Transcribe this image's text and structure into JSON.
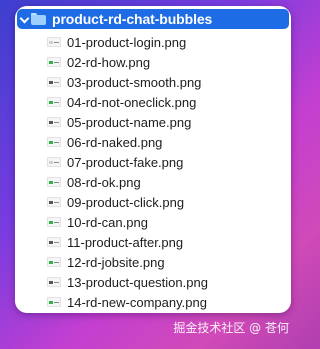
{
  "folder": {
    "name": "product-rd-chat-bubbles",
    "expanded": true
  },
  "files": [
    {
      "name": "01-product-login.png",
      "thumb_style": "plain"
    },
    {
      "name": "02-rd-how.png",
      "thumb_style": "green"
    },
    {
      "name": "03-product-smooth.png",
      "thumb_style": "dark"
    },
    {
      "name": "04-rd-not-oneclick.png",
      "thumb_style": "green"
    },
    {
      "name": "05-product-name.png",
      "thumb_style": "dark"
    },
    {
      "name": "06-rd-naked.png",
      "thumb_style": "green"
    },
    {
      "name": "07-product-fake.png",
      "thumb_style": "plain"
    },
    {
      "name": "08-rd-ok.png",
      "thumb_style": "green"
    },
    {
      "name": "09-product-click.png",
      "thumb_style": "dark"
    },
    {
      "name": "10-rd-can.png",
      "thumb_style": "green"
    },
    {
      "name": "11-product-after.png",
      "thumb_style": "dark"
    },
    {
      "name": "12-rd-jobsite.png",
      "thumb_style": "green"
    },
    {
      "name": "13-product-question.png",
      "thumb_style": "dark"
    },
    {
      "name": "14-rd-new-company.png",
      "thumb_style": "green"
    }
  ],
  "watermark": {
    "text": "掘金技术社区 @ 苍何"
  },
  "colors": {
    "selection": "#1e6be6",
    "folder_icon": "#9ed0ff",
    "thumb_green": "#2fb34a"
  }
}
